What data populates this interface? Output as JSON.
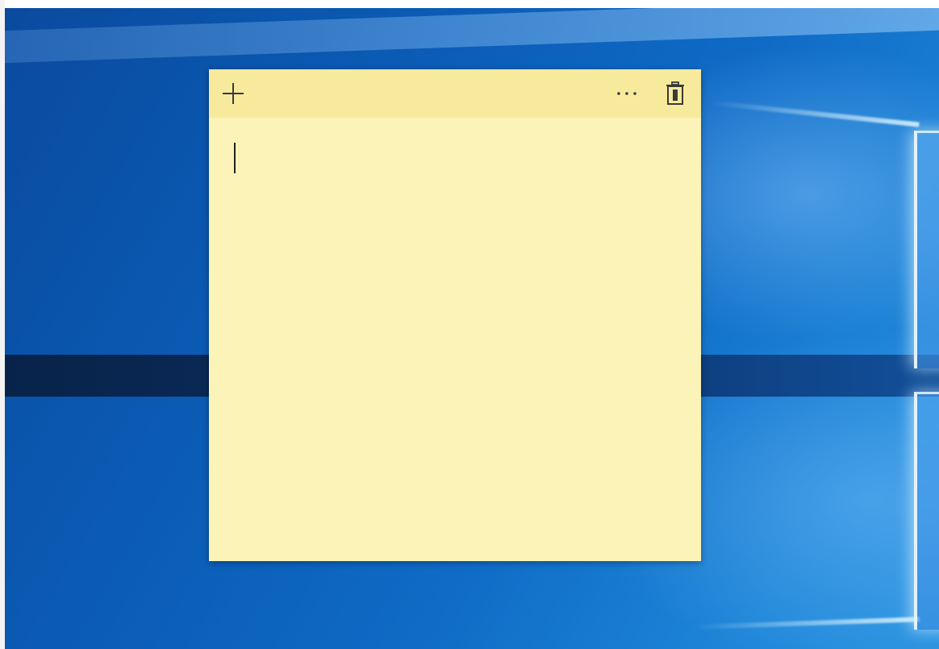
{
  "sticky_note": {
    "text": "",
    "icons": {
      "new_note": "plus-icon",
      "menu": "more-options-icon",
      "delete": "trash-icon"
    }
  },
  "colors": {
    "note_body": "#fbf3b8",
    "note_titlebar": "#f8ea9c",
    "icon": "#3a3a3a",
    "desktop_accent": "#0b5cb6"
  }
}
